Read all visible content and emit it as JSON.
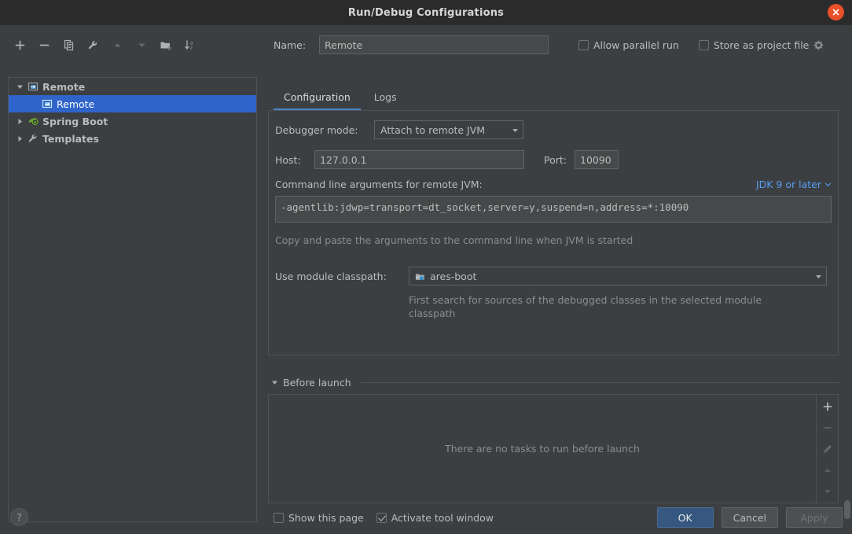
{
  "window": {
    "title": "Run/Debug Configurations",
    "close_icon": "close-icon"
  },
  "sidebar": {
    "toolbar": [
      {
        "name": "add-configuration-button",
        "icon": "plus-icon",
        "enabled": true
      },
      {
        "name": "remove-configuration-button",
        "icon": "minus-icon",
        "enabled": true
      },
      {
        "name": "copy-configuration-button",
        "icon": "copy-icon",
        "enabled": true
      },
      {
        "name": "edit-templates-button",
        "icon": "wrench-icon",
        "enabled": true
      },
      {
        "name": "move-up-button",
        "icon": "arrow-up-icon",
        "enabled": false
      },
      {
        "name": "move-down-button",
        "icon": "arrow-down-icon",
        "enabled": false
      },
      {
        "name": "new-folder-button",
        "icon": "folder-add-icon",
        "enabled": true
      },
      {
        "name": "sort-alphabetically-button",
        "icon": "sort-az-icon",
        "enabled": true
      }
    ],
    "tree": [
      {
        "label": "Remote",
        "icon": "remote-debug-icon",
        "indent": 0,
        "twisty": "expanded",
        "selected": false,
        "bold": true
      },
      {
        "label": "Remote",
        "icon": "remote-debug-icon",
        "indent": 1,
        "twisty": "none",
        "selected": true,
        "bold": false
      },
      {
        "label": "Spring Boot",
        "icon": "spring-boot-icon",
        "indent": 0,
        "twisty": "collapsed",
        "selected": false,
        "bold": true
      },
      {
        "label": "Templates",
        "icon": "wrench-icon",
        "indent": 0,
        "twisty": "collapsed",
        "selected": false,
        "bold": true
      }
    ]
  },
  "header": {
    "name_label": "Name:",
    "name_value": "Remote",
    "allow_parallel_run": {
      "label": "Allow parallel run",
      "checked": false
    },
    "store_as_project_file": {
      "label": "Store as project file",
      "checked": false,
      "icon": "gear-icon"
    }
  },
  "tabs": [
    {
      "label": "Configuration",
      "active": true
    },
    {
      "label": "Logs",
      "active": false
    }
  ],
  "configuration": {
    "debugger_mode_label": "Debugger mode:",
    "debugger_mode_value": "Attach to remote JVM",
    "host_label": "Host:",
    "host_value": "127.0.0.1",
    "port_label": "Port:",
    "port_value": "10090",
    "cmdline_label": "Command line arguments for remote JVM:",
    "jdk_link": "JDK 9 or later",
    "cmdline_value": "-agentlib:jdwp=transport=dt_socket,server=y,suspend=n,address=*:10090",
    "cmdline_hint": "Copy and paste the arguments to the command line when JVM is started",
    "module_classpath_label": "Use module classpath:",
    "module_classpath_value": "ares-boot",
    "module_classpath_icon": "module-icon",
    "module_classpath_hint": "First search for sources of the debugged classes in the selected module classpath"
  },
  "before_launch": {
    "title": "Before launch",
    "empty_text": "There are no tasks to run before launch",
    "actions": [
      {
        "name": "add-task-button",
        "icon": "plus-icon",
        "enabled": true
      },
      {
        "name": "remove-task-button",
        "icon": "minus-icon",
        "enabled": false
      },
      {
        "name": "edit-task-button",
        "icon": "pencil-icon",
        "enabled": false
      },
      {
        "name": "move-task-up-button",
        "icon": "arrow-up-icon",
        "enabled": false
      },
      {
        "name": "move-task-down-button",
        "icon": "arrow-down-icon",
        "enabled": false
      }
    ]
  },
  "footer": {
    "show_this_page": {
      "label": "Show this page",
      "checked": false
    },
    "activate_tool_window": {
      "label": "Activate tool window",
      "checked": true
    },
    "ok_label": "OK",
    "cancel_label": "Cancel",
    "apply_label": "Apply",
    "apply_enabled": false,
    "help_label": "?"
  },
  "colors": {
    "background": "#3c3f41",
    "titlebar": "#2b2b2b",
    "selection": "#2f65ca",
    "link": "#589df6",
    "accent_tab": "#4a88c7",
    "primary_button": "#365880",
    "close_button": "#e8502a"
  }
}
